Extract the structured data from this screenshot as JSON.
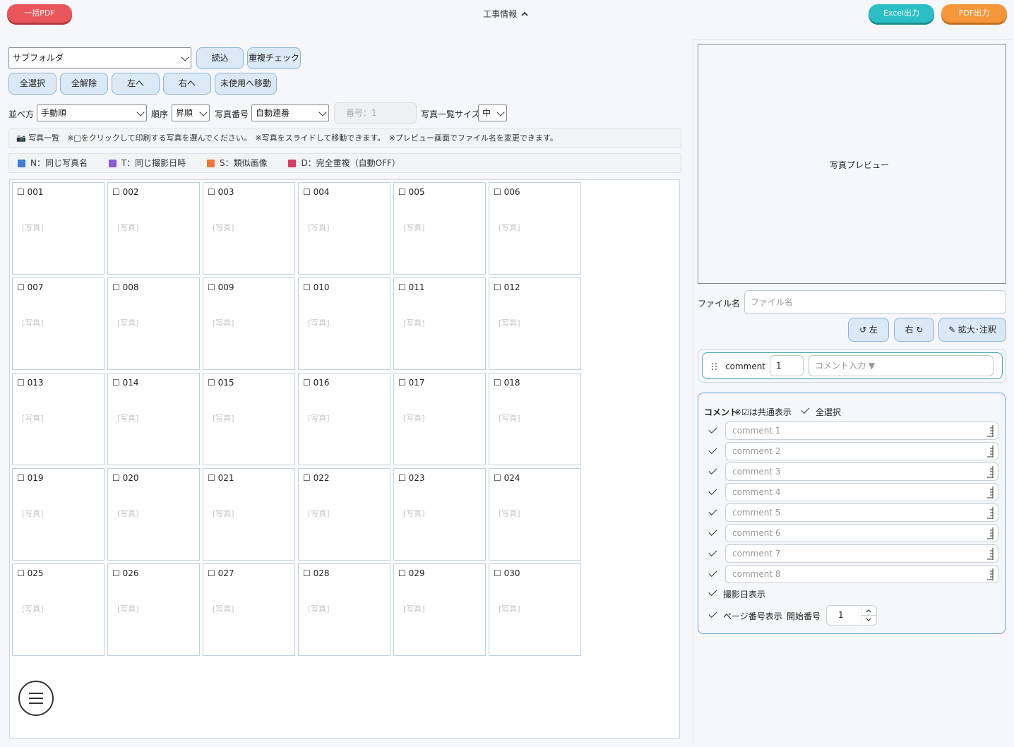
{
  "header": {
    "bulk_pdf": "一括PDF",
    "title": "工事情報",
    "excel_export": "Excel出力",
    "pdf_export": "PDF出力"
  },
  "toolbar": {
    "folder_select": "サブフォルダ",
    "load": "読込",
    "dup_check": "重複チェック",
    "select_all": "全選択",
    "deselect_all": "全解除",
    "move_left": "左へ",
    "move_right": "右へ",
    "move_unused": "未使用へ移動"
  },
  "sort": {
    "sort_label": "並べ方",
    "sort_value": "手動順",
    "order_label": "順序",
    "order_value": "昇順",
    "photo_no_label": "写真番号",
    "photo_no_value": "自動連番",
    "number_placeholder": "番号：1",
    "size_label": "写真一覧サイズ",
    "size_value": "中"
  },
  "info": {
    "icon": "camera-icon",
    "text": "📷 写真一覧　※□をクリックして印刷する写真を選んでください。　※写真をスライドして移動できます。　※プレビュー画面でファイル名を変更できます。"
  },
  "legend": [
    {
      "label": "N：同じ写真名",
      "color": "#3b7dd8"
    },
    {
      "label": "T：同じ撮影日時",
      "color": "#8a5ad8"
    },
    {
      "label": "S：類似画像",
      "color": "#f0763a"
    },
    {
      "label": "D：完全重複（自動OFF）",
      "color": "#d83b5e"
    }
  ],
  "photos": {
    "placeholder": "[写真]",
    "items": [
      "☐ 001",
      "☐ 002",
      "☐ 003",
      "☐ 004",
      "☐ 005",
      "☐ 006",
      "☐ 007",
      "☐ 008",
      "☐ 009",
      "☐ 010",
      "☐ 011",
      "☐ 012",
      "☐ 013",
      "☐ 014",
      "☐ 015",
      "☐ 016",
      "☐ 017",
      "☐ 018",
      "☐ 019",
      "☐ 020",
      "☐ 021",
      "☐ 022",
      "☐ 023",
      "☐ 024",
      "☐ 025",
      "☐ 026",
      "☐ 027",
      "☐ 028",
      "☐ 029",
      "☐ 030"
    ]
  },
  "preview": {
    "label": "写真プレビュー",
    "filename_label": "ファイル名",
    "filename_placeholder": "ファイル名",
    "rotate_left": "↺ 左",
    "rotate_right": "右 ↻",
    "zoom_annotate": "✎ 拡大･注釈"
  },
  "comment_row": {
    "label": "comment",
    "number": "1",
    "input_placeholder": "コメント入力 ▼"
  },
  "comments": {
    "title": "コメント",
    "note": "※☑は共通表示",
    "select_all": "全選択",
    "fields": [
      "comment 1",
      "comment 2",
      "comment 3",
      "comment 4",
      "comment 5",
      "comment 6",
      "comment 7",
      "comment 8"
    ],
    "show_date": "撮影日表示",
    "show_page": "ページ番号表示",
    "start_label": "開始番号",
    "start_value": "1"
  }
}
